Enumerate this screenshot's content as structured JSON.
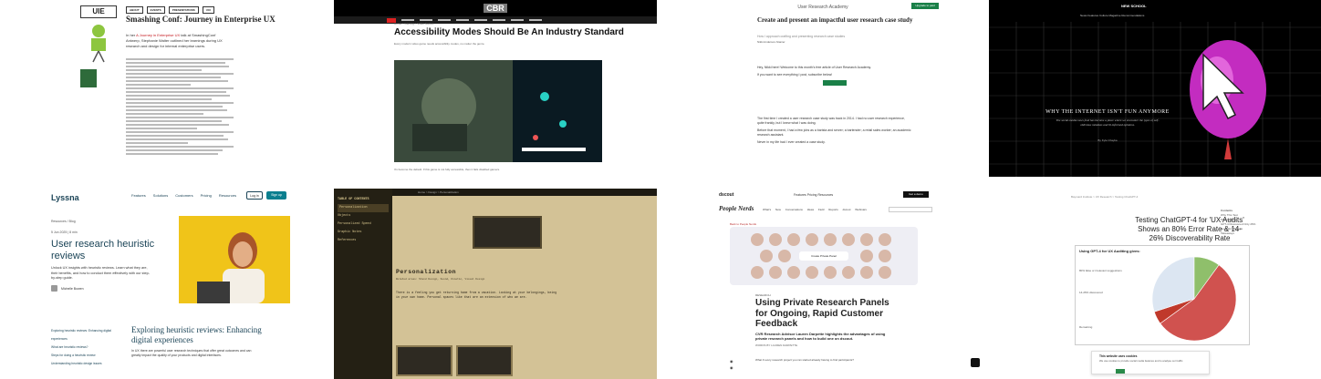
{
  "tile1": {
    "brand": "UIE",
    "nav": [
      "ABOUT",
      "EVENTS",
      "PRESENTATIONS",
      "UXI"
    ],
    "title": "Smashing Conf: Journey in Enterprise UX",
    "intro": "In her",
    "intro_link": "A Journey in Enterprise UX",
    "intro_rest": "talk at SmashingConf Antwerp, Stephanie Walter outlined her learnings during UX research and design for internal enterprise users."
  },
  "tile2": {
    "logo": "CBR",
    "crumb": "Home > Gaming > Video Games",
    "title": "Accessibility Modes Should Be An Industry Standard",
    "dek": "Every modern video game needs accessibility modes, no matter the genre.",
    "caption": "It's become the default. If this game is not fully accessible, then it fails disabled gamers."
  },
  "tile3": {
    "site": "User Research Academy",
    "btn": "Upgrade to paid",
    "title": "Create and present an impactful user research case study",
    "sub": "How I approach crafting and presenting research case studies",
    "author": "Nikki Anderson-Stanier",
    "p1": "Hey, Nikki here! Welcome to this month's free article of User Research Academy.",
    "p2": "If you want to see everything I post, subscribe below!",
    "p3": "The first time I created a user research case study was back in 2014. I had no user research experience, quite frankly, but I knew what I was doing.",
    "p4": "Before that moment, I had a few jobs as a barista and server; a bartender; a retail sales worker; an academic research assistant.",
    "p5": "Never in my life had I ever created a case study."
  },
  "tile4": {
    "masthead": "NEW SCHOOL",
    "nav": "News  Features  Culture  Magazine  Recommendations",
    "title": "WHY THE INTERNET ISN'T FUN ANYMORE",
    "sub": "The social-media news feed has become a place where we encounter the types of self-oblivious mistakes and ill-informed opinions.",
    "byline": "By Kyle Chayka"
  },
  "tile5": {
    "logo": "Lyssna",
    "nav": [
      "Features",
      "Solutions",
      "Customers",
      "Pricing",
      "Resources"
    ],
    "login": "Log in",
    "signup": "Sign up",
    "crumb": "Resources / Blog",
    "date": "5 Jun 2025  |  8 min",
    "title": "User research heuristic reviews",
    "dek": "Unlock UX insights with heuristic reviews. Learn what they are, their benefits, and how to conduct them effectively with our step-by-step guide.",
    "author": "Michelle Bowen",
    "toc": [
      "Exploring heuristic reviews: Enhancing digital experiences",
      "What are heuristic reviews?",
      "Steps for doing a heuristic review",
      "Understanding heuristic design issues"
    ],
    "h2": "Exploring heuristic reviews: Enhancing digital experiences",
    "p2": "In UX there are powerful user research techniques that offer great outcomes and can greatly impact the quality of your products and digital interfaces."
  },
  "tile6": {
    "sidebar_title": "TABLE OF CONTENTS",
    "sidebar": [
      "Personalization",
      "Objects",
      "Personalized Speed",
      "Graphic Notes",
      "References"
    ],
    "crumb": "Home > Design > Personalization",
    "heading": "Personalization",
    "meta": "Related areas: Stand Design, Sound, Kinetic, Visual Design",
    "para": "There is a feeling you get returning home from a vacation. Looking at your belongings, being in your own home. Personal spaces like that are an extension of who we are."
  },
  "tile7": {
    "brand": "dscout",
    "nav": "Features  Pricing  Resources",
    "cta": "Get a demo",
    "pn": "People Nerds",
    "tabs": "What's New  Conversations  Ideas  Field Reports  dscout  Webinars",
    "small": "Back to People Nerds",
    "panel": "Create Private Panel",
    "kicker": "RESEARCH",
    "title": "Using Private Research Panels for Ongoing, Rapid Customer Feedback",
    "dek": "CVR Research Advisor Lauren Darpette highlights the advantages of using private research panels and how to build one on dscout.",
    "by": "WORDS BY LAUREN DARPETTE",
    "p": "What if every research project you ran started already having to find participants?"
  },
  "tile8": {
    "crumb": "Baymard Institute > UX Research > Testing ChatGPT-4",
    "title": "Testing ChatGPT-4 for 'UX Audits' Shows an 80% Error Rate & 14-26% Discoverability Rate",
    "rightnav": [
      "Contents",
      "Why This Test",
      "Methodology",
      "GPT-4 Discovered Only 26%",
      "Heuristics Results",
      "Takeaways"
    ],
    "cookie_title": "This website uses cookies",
    "cookie_body": "We use cookies to provide social media features and to analyse our traffic.",
    "chart_data": {
      "type": "pie",
      "title": "Using GPT-4 for UX Auditing gives:",
      "categories": [
        "80% false or irrelevant suggestions",
        "14-26% discovered",
        "Remaining"
      ],
      "values": [
        55,
        5,
        30,
        10
      ],
      "colors": [
        "#d0524f",
        "#c0392b",
        "#dce6f2",
        "#8fbf6b"
      ]
    }
  }
}
